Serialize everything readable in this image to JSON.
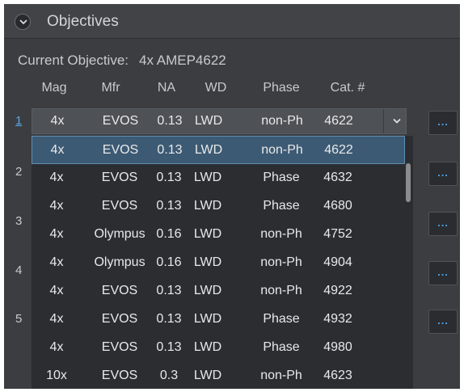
{
  "panel": {
    "title": "Objectives",
    "collapse_icon": "chevron-down-icon"
  },
  "current": {
    "label": "Current Objective:",
    "value": "4x AMEP4622"
  },
  "columns": [
    "Mag",
    "Mfr",
    "NA",
    "WD",
    "Phase",
    "Cat. #"
  ],
  "slots": [
    {
      "number": "1",
      "active": true
    },
    {
      "number": "2",
      "active": false
    },
    {
      "number": "3",
      "active": false
    },
    {
      "number": "4",
      "active": false
    },
    {
      "number": "5",
      "active": false
    }
  ],
  "selected": {
    "mag": "4x",
    "mfr": "EVOS",
    "na": "0.13",
    "wd": "LWD",
    "phase": "non-Ph",
    "cat": "4622"
  },
  "options": [
    {
      "mag": "4x",
      "mfr": "EVOS",
      "na": "0.13",
      "wd": "LWD",
      "phase": "non-Ph",
      "cat": "4622"
    },
    {
      "mag": "4x",
      "mfr": "EVOS",
      "na": "0.13",
      "wd": "LWD",
      "phase": "Phase",
      "cat": "4632"
    },
    {
      "mag": "4x",
      "mfr": "EVOS",
      "na": "0.13",
      "wd": "LWD",
      "phase": "Phase",
      "cat": "4680"
    },
    {
      "mag": "4x",
      "mfr": "Olympus",
      "na": "0.16",
      "wd": "LWD",
      "phase": "non-Ph",
      "cat": "4752"
    },
    {
      "mag": "4x",
      "mfr": "Olympus",
      "na": "0.16",
      "wd": "LWD",
      "phase": "non-Ph",
      "cat": "4904"
    },
    {
      "mag": "4x",
      "mfr": "EVOS",
      "na": "0.13",
      "wd": "LWD",
      "phase": "non-Ph",
      "cat": "4922"
    },
    {
      "mag": "4x",
      "mfr": "EVOS",
      "na": "0.13",
      "wd": "LWD",
      "phase": "Phase",
      "cat": "4932"
    },
    {
      "mag": "4x",
      "mfr": "EVOS",
      "na": "0.13",
      "wd": "LWD",
      "phase": "Phase",
      "cat": "4980"
    },
    {
      "mag": "10x",
      "mfr": "EVOS",
      "na": "0.3",
      "wd": "LWD",
      "phase": "non-Ph",
      "cat": "4623"
    }
  ],
  "highlighted_option": 0,
  "more_button_label": "...",
  "colors": {
    "panel_bg": "#3b3d40",
    "accent_blue": "#4ea3e6",
    "highlight": "#3c5a73"
  }
}
